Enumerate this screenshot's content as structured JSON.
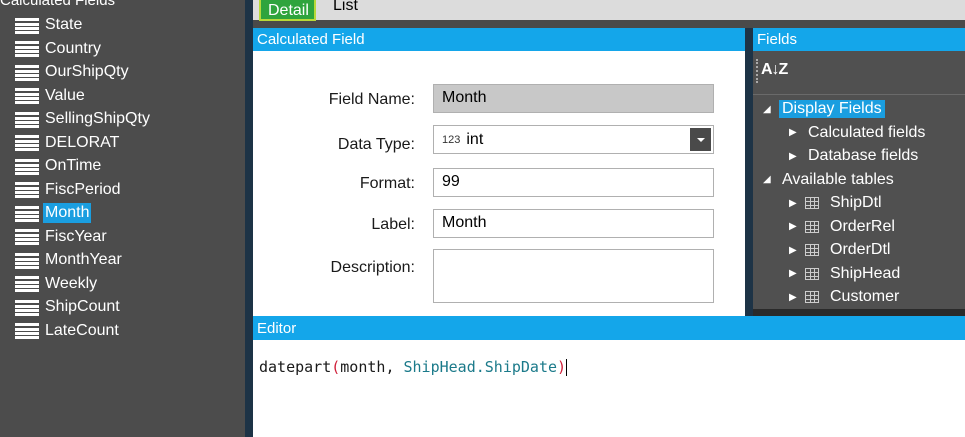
{
  "left_panel": {
    "header": "Calculated Fields",
    "items": [
      {
        "label": "State"
      },
      {
        "label": "Country"
      },
      {
        "label": "OurShipQty"
      },
      {
        "label": "Value"
      },
      {
        "label": "SellingShipQty"
      },
      {
        "label": "DELORAT"
      },
      {
        "label": "OnTime"
      },
      {
        "label": "FiscPeriod"
      },
      {
        "label": "Month",
        "selected": true
      },
      {
        "label": "FiscYear"
      },
      {
        "label": "MonthYear"
      },
      {
        "label": "Weekly"
      },
      {
        "label": "ShipCount"
      },
      {
        "label": "LateCount"
      }
    ]
  },
  "tabs": {
    "detail": "Detail",
    "list": "List"
  },
  "calculated_field": {
    "header": "Calculated Field",
    "field_name_label": "Field Name:",
    "field_name_value": "Month",
    "data_type_label": "Data Type:",
    "data_type_prefix": "123",
    "data_type_value": "int",
    "format_label": "Format:",
    "format_value": "99",
    "label_label": "Label:",
    "label_value": "Month",
    "description_label": "Description:",
    "description_value": ""
  },
  "fields_panel": {
    "header": "Fields",
    "sort_icon": "A↓Z",
    "tree": [
      {
        "label": "Display Fields",
        "expanded": true,
        "selected": true
      },
      {
        "label": "Calculated fields"
      },
      {
        "label": "Database fields"
      },
      {
        "label": "Available tables",
        "expanded": true
      },
      {
        "label": "ShipDtl"
      },
      {
        "label": "OrderRel"
      },
      {
        "label": "OrderDtl"
      },
      {
        "label": "ShipHead"
      },
      {
        "label": "Customer"
      }
    ]
  },
  "editor": {
    "header": "Editor",
    "code": {
      "fn": "datepart",
      "open": "(",
      "arg1": "month",
      "comma": ", ",
      "arg2": "ShipHead.ShipDate",
      "close": ")"
    }
  }
}
